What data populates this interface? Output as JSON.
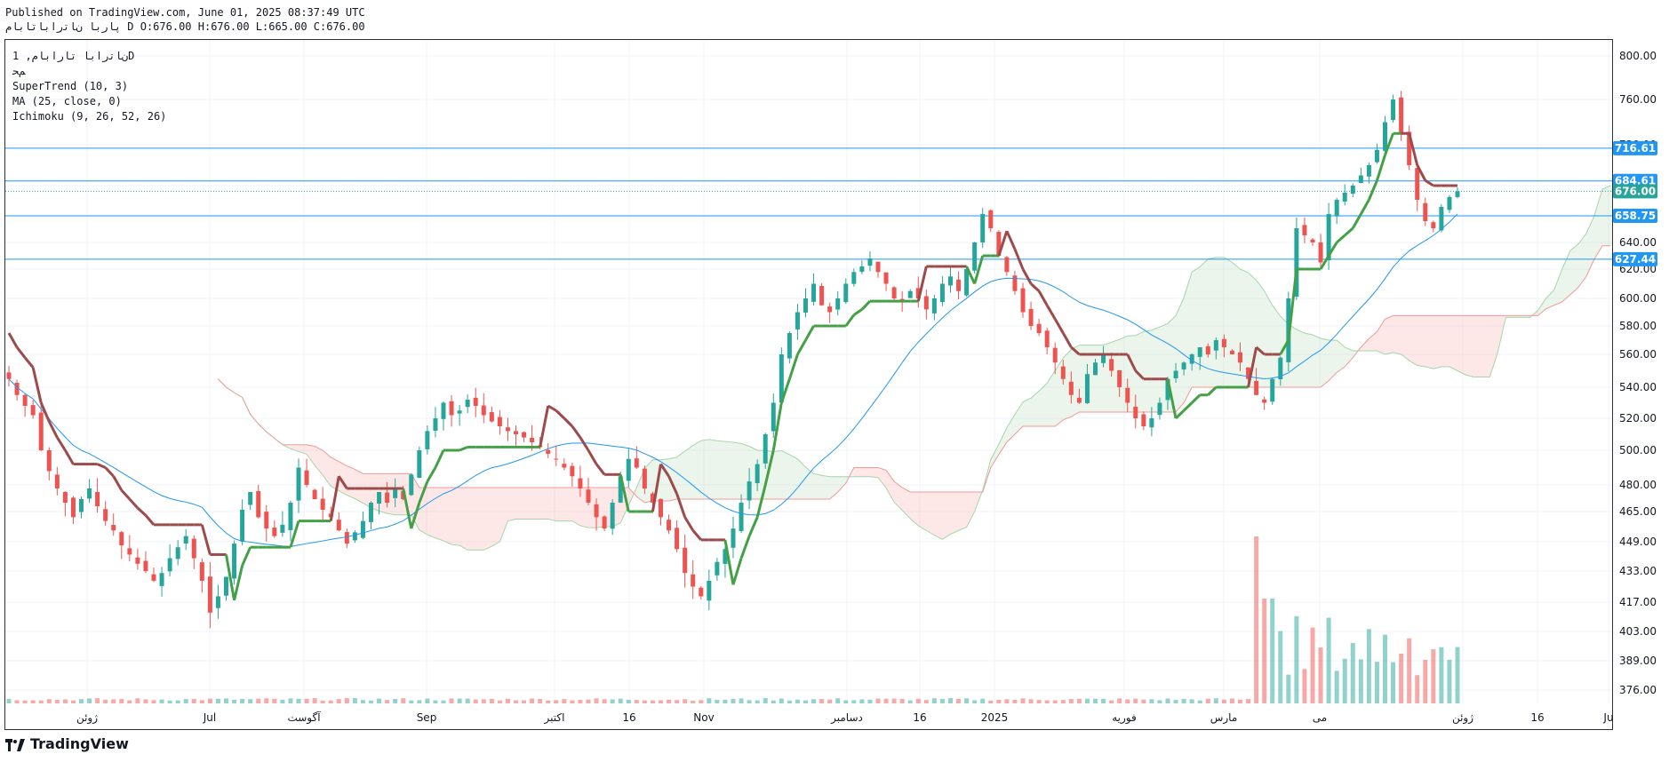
{
  "header": {
    "published": "Published on TradingView.com, June 01, 2025 08:37:49 UTC",
    "ohlc": "پارﺑﺎ ﻥﺎﺗراﺑﺎﺗﺎﺑﺎﻡ D O:676.00 H:676.00 L:665.00 C:676.00"
  },
  "legend": {
    "symbol": "ﻥﺎﺗراﺑﺎ ﺗﺎراﺑﺎﻡ, 1D",
    "sub": "ﻢﺤ",
    "supertrend": "SuperTrend (10, 3)",
    "ma": "MA (25, close, 0)",
    "ichimoku": "Ichimoku (9, 26, 52, 26)"
  },
  "brand": {
    "name": "TradingView"
  },
  "colors": {
    "up": "#26a69a",
    "down": "#ef5350",
    "hline": "#2196f3",
    "ma": "#2196f3",
    "st_up": "#43a047",
    "st_down": "#9c4a4a",
    "last": "#26a69a"
  },
  "chart_data": {
    "type": "candlestick",
    "y_ticks": [
      800,
      760,
      720,
      680,
      640,
      620,
      600,
      580,
      560,
      540,
      520,
      500,
      480,
      465,
      449,
      433,
      417,
      403,
      389,
      376
    ],
    "x_ticks": [
      "ژوئن",
      "Jul",
      "آگوست",
      "Sep",
      "اکتبر",
      "16",
      "Nov",
      "دسامبر",
      "16",
      "2025",
      "فوریه",
      "مارس",
      "می",
      "ژوئن",
      "16",
      "Ju"
    ],
    "price_labels": [
      {
        "value": 716.61,
        "label": "716.61",
        "kind": "hline"
      },
      {
        "value": 684.61,
        "label": "684.61",
        "kind": "hline"
      },
      {
        "value": 676.0,
        "label": "676.00",
        "kind": "last"
      },
      {
        "value": 658.75,
        "label": "658.75",
        "kind": "hline"
      },
      {
        "value": 627.44,
        "label": "627.44",
        "kind": "hline"
      }
    ],
    "candles_close": [
      545,
      535,
      528,
      522,
      500,
      488,
      478,
      470,
      462,
      472,
      478,
      468,
      460,
      455,
      447,
      442,
      437,
      433,
      428,
      432,
      440,
      446,
      452,
      440,
      428,
      412,
      420,
      430,
      448,
      466,
      476,
      462,
      456,
      452,
      458,
      470,
      490,
      480,
      472,
      466,
      462,
      455,
      448,
      454,
      460,
      470,
      476,
      470,
      478,
      472,
      486,
      500,
      512,
      520,
      530,
      522,
      525,
      532,
      528,
      522,
      518,
      515,
      512,
      510,
      508,
      505,
      502,
      498,
      495,
      490,
      485,
      478,
      470,
      462,
      456,
      470,
      485,
      495,
      490,
      478,
      470,
      462,
      455,
      445,
      432,
      425,
      420,
      428,
      438,
      445,
      456,
      470,
      482,
      492,
      510,
      530,
      560,
      575,
      590,
      600,
      610,
      595,
      590,
      600,
      610,
      618,
      622,
      628,
      618,
      610,
      600,
      598,
      605,
      600,
      592,
      600,
      610,
      615,
      605,
      620,
      640,
      660,
      650,
      630,
      618,
      605,
      590,
      580,
      575,
      565,
      555,
      545,
      535,
      530,
      548,
      555,
      560,
      550,
      540,
      530,
      520,
      515,
      520,
      530,
      545,
      550,
      555,
      560,
      565,
      560,
      570,
      565,
      560,
      555,
      545,
      535,
      530,
      545,
      558,
      600,
      650,
      645,
      640,
      625,
      660,
      670,
      675,
      680,
      690,
      700,
      715,
      740,
      760,
      730,
      700,
      670,
      655,
      650,
      665,
      672,
      676
    ],
    "ma_start": 576,
    "ma_end": 660
  }
}
